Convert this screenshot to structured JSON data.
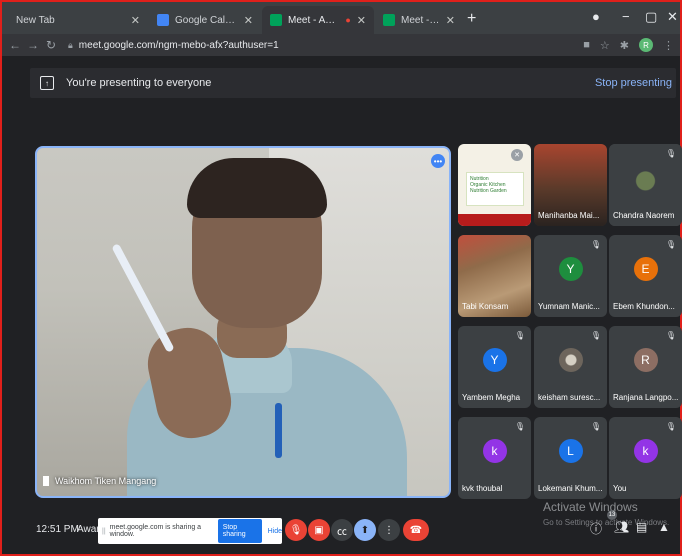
{
  "browser": {
    "tabs": [
      {
        "title": "New Tab",
        "fav_color": ""
      },
      {
        "title": "Google Calendar - July 2021",
        "fav_color": "#4285f4"
      },
      {
        "title": "Meet - Awareness program :",
        "fav_color": "#00a25a"
      },
      {
        "title": "Meet - Awareness program on C",
        "fav_color": "#00a25a"
      }
    ],
    "new_tab": "+",
    "url": "meet.google.com/ngm-mebo-afx?authuser=1",
    "profile_initial": "R"
  },
  "meet": {
    "banner_text": "You're presenting to everyone",
    "stop_presenting": "Stop presenting",
    "main_speaker": "Waikhom Tiken Mangang",
    "tiles": [
      {
        "name": "",
        "kind": "presentation",
        "lines": [
          "Nutrition",
          "Organic Kitchen",
          "Nutrition Garden"
        ]
      },
      {
        "name": "Manihanba Mai...",
        "kind": "video"
      },
      {
        "name": "Chandra Naorem",
        "kind": "video"
      },
      {
        "name": "Tabi Konsam",
        "kind": "video"
      },
      {
        "name": "Yumnam Manic...",
        "kind": "avatar",
        "initial": "Y",
        "color": "#1e8e3e"
      },
      {
        "name": "Ebem Khundon...",
        "kind": "avatar",
        "initial": "E",
        "color": "#e8710a"
      },
      {
        "name": "Yambem Megha",
        "kind": "avatar",
        "initial": "Y",
        "color": "#1a73e8"
      },
      {
        "name": "keisham suresc...",
        "kind": "photo"
      },
      {
        "name": "Ranjana Langpo...",
        "kind": "avatar",
        "initial": "R",
        "color": "#8d6e63"
      },
      {
        "name": "kvk thoubal",
        "kind": "avatar",
        "initial": "k",
        "color": "#9334e6"
      },
      {
        "name": "Lokemani Khum...",
        "kind": "avatar",
        "initial": "L",
        "color": "#1a73e8"
      },
      {
        "name": "You",
        "kind": "avatar",
        "initial": "k",
        "color": "#9334e6"
      }
    ],
    "clock": "12:51 PM",
    "meeting_short": "Awar",
    "share_message": "meet.google.com is sharing a window.",
    "stop_sharing": "Stop sharing",
    "hide": "Hide",
    "participants_count": "13"
  },
  "windows": {
    "activate_title": "Activate Windows",
    "activate_sub": "Go to Settings to activate Windows."
  }
}
